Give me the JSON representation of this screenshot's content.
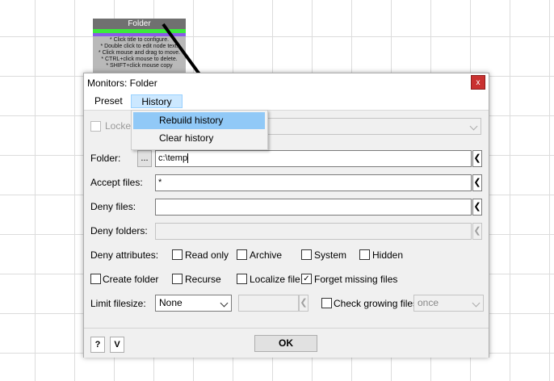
{
  "background_node": {
    "title": "Folder",
    "help_text": "* Click title to configure.\n* Double click to edit node text.\n* Click mouse and drag to move.\n* CTRL+click mouse to delete.\n* SHIFT+click mouse copy"
  },
  "dialog": {
    "title": "Monitors: Folder",
    "close_label": "x",
    "menu": {
      "preset_label": "Preset",
      "history_label": "History"
    },
    "history_menu": {
      "items": [
        "Rebuild history",
        "Clear history"
      ]
    },
    "locked": {
      "label": "Locked",
      "checked": false
    },
    "folder": {
      "label": "Folder:",
      "browse_label": "...",
      "value": "c:\\temp"
    },
    "accept_files": {
      "label": "Accept files:",
      "value": "*"
    },
    "deny_files": {
      "label": "Deny files:",
      "value": ""
    },
    "deny_folders": {
      "label": "Deny folders:",
      "value": ""
    },
    "deny_attributes": {
      "label": "Deny attributes:",
      "read_only": "Read only",
      "archive": "Archive",
      "system": "System",
      "hidden": "Hidden"
    },
    "options": {
      "create_folder": "Create folder",
      "recurse": "Recurse",
      "localize_file": "Localize file",
      "forget_missing_files": "Forget missing files",
      "forget_missing_checked": true
    },
    "limit_filesize": {
      "label": "Limit filesize:",
      "selected": "None",
      "check_growing_label": "Check growing files",
      "growing_selected": "once"
    },
    "footer": {
      "help_label": "?",
      "v_label": "V",
      "ok_label": "OK"
    }
  },
  "colors": {
    "menu_highlight": "#cce8ff",
    "menu_item_hover": "#91c9f7",
    "close_button": "#c93130",
    "node_header": "#707070",
    "node_green": "#3ce93c",
    "node_purple": "#8a5ae8"
  },
  "icons": {
    "arrow": "left-arrow-icon",
    "chevron": "chevron-down-icon",
    "check": "check-icon"
  }
}
